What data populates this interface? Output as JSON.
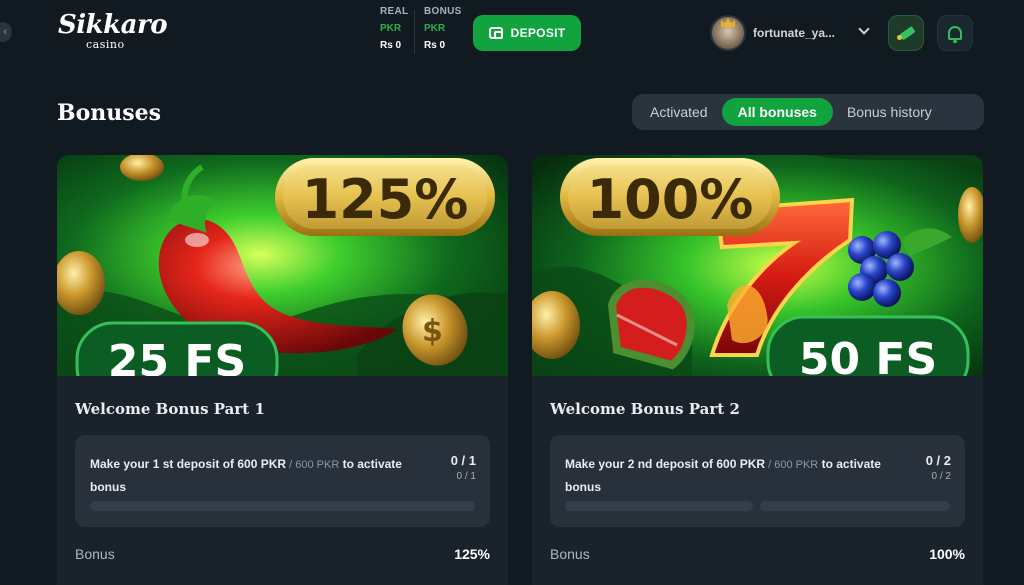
{
  "header": {
    "logo_main": "Sikkaro",
    "logo_sub": "casino",
    "balances": [
      {
        "title": "REAL",
        "currency": "PKR",
        "value": "Rs 0"
      },
      {
        "title": "BONUS",
        "currency": "PKR",
        "value": "Rs 0"
      }
    ],
    "deposit_label": "DEPOSIT",
    "username": "fortunate_ya..."
  },
  "page": {
    "title": "Bonuses",
    "tabs": [
      {
        "label": "Activated",
        "active": false
      },
      {
        "label": "All bonuses",
        "active": true
      },
      {
        "label": "Bonus history",
        "active": false
      }
    ]
  },
  "cards": [
    {
      "banner_percent": "125%",
      "banner_fs": "25 FS",
      "name": "Welcome Bonus Part 1",
      "req_main": "Make your 1 st deposit of 600 PKR",
      "req_dim": " / 600 PKR",
      "req_tail": " to activate bonus",
      "count_big": "0 / 1",
      "count_small": "0 / 1",
      "progress": 0,
      "stat_label": "Bonus",
      "stat_value": "125%"
    },
    {
      "banner_percent": "100%",
      "banner_fs": "50 FS",
      "name": "Welcome Bonus Part 2",
      "req_main": "Make your 2 nd deposit of 600 PKR",
      "req_dim": " / 600 PKR",
      "req_tail": " to activate bonus",
      "count_big": "0 / 2",
      "count_small": "0 / 2",
      "progress": 0,
      "stat_label": "Bonus",
      "stat_value": "100%"
    }
  ],
  "colors": {
    "background": "#121a21",
    "accent_green": "#10a33e",
    "card_bg": "#1a232c",
    "box_bg": "#28313b"
  },
  "icons": [
    "chevron-left-icon",
    "wallet-icon",
    "avatar-crown-icon",
    "chevron-down-icon",
    "rocket-icon",
    "bell-icon",
    "coin-icon",
    "chili-icon",
    "seven-icon",
    "grapes-icon",
    "watermelon-icon"
  ]
}
